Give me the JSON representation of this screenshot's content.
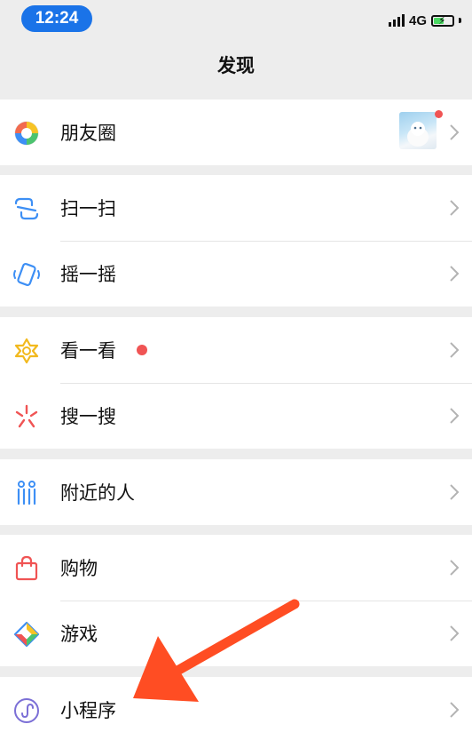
{
  "status_bar": {
    "time": "12:24",
    "network": "4G"
  },
  "nav": {
    "title": "发现"
  },
  "groups": [
    {
      "items": [
        {
          "label": "朋友圈",
          "icon": "moments-icon"
        }
      ]
    },
    {
      "items": [
        {
          "label": "扫一扫",
          "icon": "scan-icon"
        },
        {
          "label": "摇一摇",
          "icon": "shake-icon"
        }
      ]
    },
    {
      "items": [
        {
          "label": "看一看",
          "icon": "top-stories-icon"
        },
        {
          "label": "搜一搜",
          "icon": "search-icon"
        }
      ]
    },
    {
      "items": [
        {
          "label": "附近的人",
          "icon": "people-nearby-icon"
        }
      ]
    },
    {
      "items": [
        {
          "label": "购物",
          "icon": "shopping-bag-icon"
        },
        {
          "label": "游戏",
          "icon": "games-icon"
        }
      ]
    },
    {
      "items": [
        {
          "label": "小程序",
          "icon": "mini-programs-icon"
        }
      ]
    }
  ],
  "colors": {
    "accent_blue": "#1a73e8",
    "red_dot": "#f05454",
    "arrow": "#ff4d23"
  }
}
